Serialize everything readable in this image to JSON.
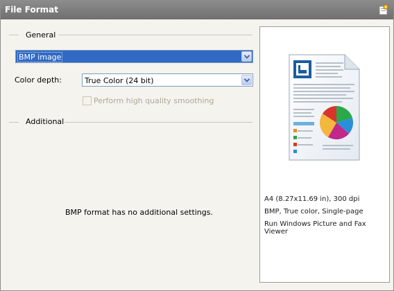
{
  "panel": {
    "title": "File Format",
    "title_icon": "printer-settings-icon"
  },
  "general": {
    "label": "General",
    "format_value": "BMP image",
    "color_depth_label": "Color depth:",
    "color_depth_value": "True Color (24 bit)",
    "smoothing_label": "Perform high quality smoothing",
    "smoothing_checked": false,
    "smoothing_enabled": false
  },
  "additional": {
    "label": "Additional",
    "message": "BMP format has no additional settings."
  },
  "preview": {
    "icon": "document-with-chart-icon",
    "lines": [
      "A4 (8.27x11.69 in), 300 dpi",
      "BMP, True color, Single-page",
      "Run Windows Picture and Fax Viewer"
    ]
  },
  "colors": {
    "selection": "#316ac5",
    "title_bar": "#7a7a7a",
    "panel_bg": "#f4f3ee"
  }
}
